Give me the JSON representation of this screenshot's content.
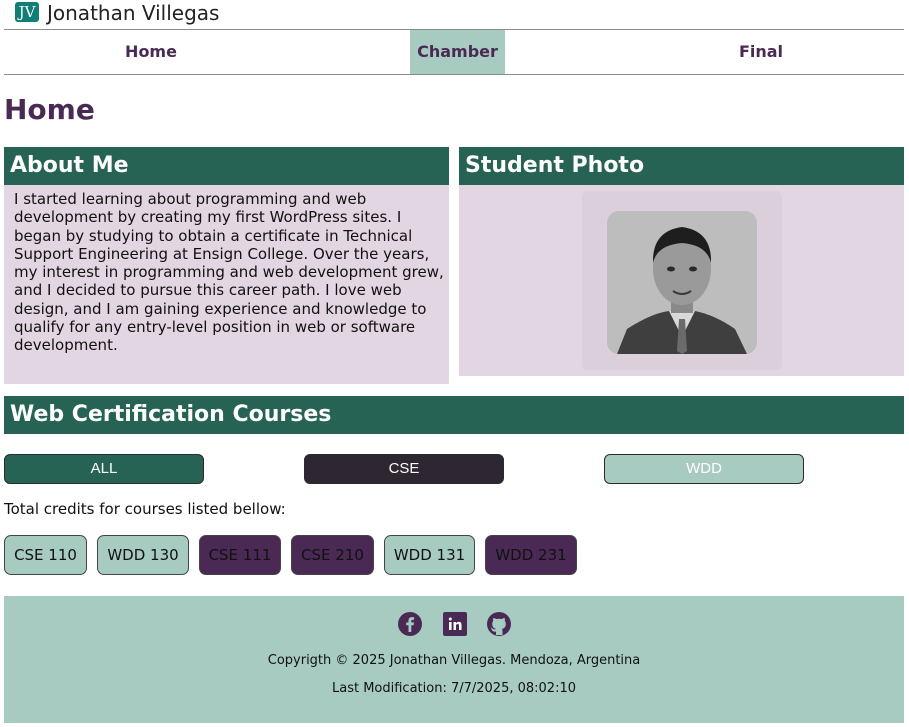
{
  "header": {
    "logo_text": "JV",
    "name": "Jonathan Villegas"
  },
  "nav": {
    "items": [
      {
        "label": "Home"
      },
      {
        "label": "Chamber"
      },
      {
        "label": "Final"
      }
    ],
    "active": "Chamber"
  },
  "page": {
    "title": "Home"
  },
  "about": {
    "title": "About Me",
    "text": "I started learning about programming and web development by creating my first WordPress sites. I began by studying to obtain a certificate in Technical Support Engineering at Ensign College. Over the years, my interest in programming and web development grew, and I decided to pursue this career path. I love web design, and I am gaining experience and knowledge to qualify for any entry-level position in web or software development."
  },
  "photo": {
    "title": "Student Photo"
  },
  "courses": {
    "title": "Web Certification Courses",
    "filters": [
      {
        "label": "ALL"
      },
      {
        "label": "CSE"
      },
      {
        "label": "WDD"
      }
    ],
    "credits_label": "Total credits for courses listed bellow:",
    "items": [
      {
        "label": "CSE 110",
        "completed": false
      },
      {
        "label": "WDD 130",
        "completed": false
      },
      {
        "label": "CSE 111",
        "completed": true
      },
      {
        "label": "CSE 210",
        "completed": true
      },
      {
        "label": "WDD 131",
        "completed": false
      },
      {
        "label": "WDD 231",
        "completed": true
      }
    ]
  },
  "footer": {
    "social": [
      {
        "icon": "facebook-icon"
      },
      {
        "icon": "linkedin-icon"
      },
      {
        "icon": "github-icon"
      }
    ],
    "copyright": "Copyrigth © 2025 Jonathan Villegas. Mendoza, Argentina",
    "last_modified": "Last Modification: 7/7/2025, 08:02:10"
  },
  "colors": {
    "primary": "#276354",
    "accent": "#a7cbc1",
    "purple": "#4a2a55",
    "card_bg": "#e3d6e3",
    "dark": "#2e2631"
  }
}
